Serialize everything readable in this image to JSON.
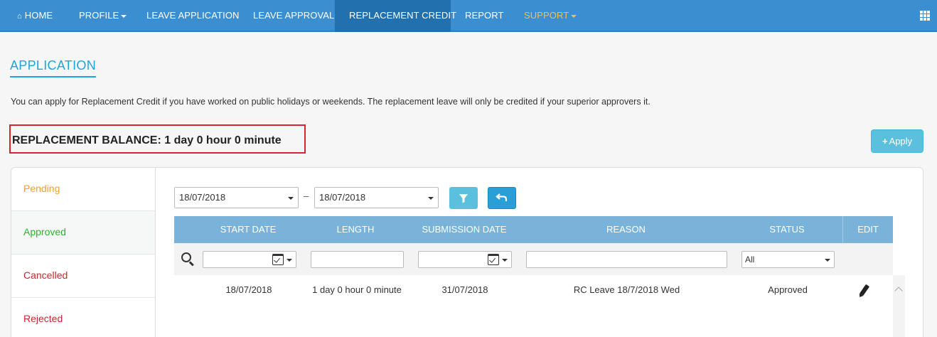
{
  "nav": {
    "home": "HOME",
    "profile": "PROFILE",
    "leave_application": "LEAVE APPLICATION",
    "leave_approval": "LEAVE APPROVAL",
    "replacement_credit": "REPLACEMENT CREDIT",
    "report": "REPORT",
    "support": "SUPPORT",
    "active_color": "#2270ad",
    "support_color": "#f3c240"
  },
  "page": {
    "title": "APPLICATION",
    "intro": "You can apply for Replacement Credit if you have worked on public holidays or weekends. The replacement leave will only be credited if your superior approvers it.",
    "balance": "REPLACEMENT BALANCE: 1 day 0 hour 0 minute",
    "apply_label": "Apply"
  },
  "sidebar": {
    "items": [
      {
        "label": "Pending",
        "color": "#f0a030"
      },
      {
        "label": "Approved",
        "color": "#2ab52a"
      },
      {
        "label": "Cancelled",
        "color": "#c9262c"
      },
      {
        "label": "Rejected",
        "color": "#c9262c"
      }
    ]
  },
  "filter": {
    "date_from": "18/07/2018",
    "date_to": "18/07/2018",
    "separator": "–"
  },
  "table": {
    "headers": {
      "start_date": "START DATE",
      "length": "LENGTH",
      "submission_date": "SUBMISSION DATE",
      "reason": "REASON",
      "status": "STATUS",
      "edit": "EDIT"
    },
    "status_filter": "All",
    "rows": [
      {
        "start_date": "18/07/2018",
        "length": "1 day 0 hour 0 minute",
        "submission_date": "31/07/2018",
        "reason": "RC Leave 18/7/2018 Wed",
        "status": "Approved"
      }
    ]
  }
}
